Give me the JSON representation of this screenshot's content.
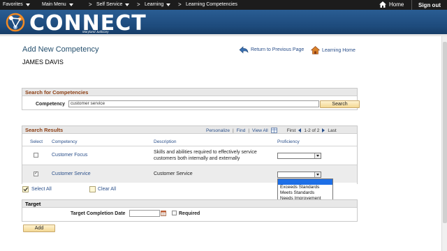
{
  "topnav": {
    "favorites": "Favorites",
    "main_menu": "Main Menu",
    "crumb_self_service": "Self Service",
    "crumb_learning": "Learning",
    "crumb_learning_competencies": "Learning Competencies",
    "sep": ">",
    "home": "Home",
    "sign_out": "Sign out"
  },
  "banner": {
    "logo": "CONNECT",
    "tagline": "Maryland Judiciary"
  },
  "page": {
    "title": "Add New Competency",
    "person": "JAMES DAVIS",
    "return_link": "Return to Previous Page",
    "learning_home": "Learning Home"
  },
  "search": {
    "heading": "Search for Competencies",
    "label": "Competency",
    "value": "customer service",
    "button": "Search"
  },
  "results": {
    "heading": "Search Results",
    "personalize": "Personalize",
    "find": "Find",
    "view_all": "View All",
    "first": "First",
    "range": "1-2 of 2",
    "last": "Last",
    "bar": "|",
    "columns": {
      "select": "Select",
      "competency": "Competency",
      "description": "Description",
      "proficiency": "Proficiency"
    },
    "rows": [
      {
        "competency": "Customer Focus",
        "description": "Skills and abilities required to effectively service customers both internally and externally",
        "checked": false
      },
      {
        "competency": "Customer Service",
        "description": "Customer Service",
        "checked": true
      }
    ],
    "select_all": "Select All",
    "clear_all": "Clear All"
  },
  "proficiency_options": [
    "",
    "Exceeds Standards",
    "Meets Standards",
    "Needs Improvement"
  ],
  "target": {
    "heading": "Target",
    "completion_label": "Target Completion Date",
    "date_value": "",
    "required_label": "Required"
  },
  "add_button": "Add",
  "colors": {
    "banner": "#1d4a7b",
    "section_title": "#8b3d12",
    "link": "#2a4f8a",
    "dropdown_highlight": "#1e6fe6"
  }
}
